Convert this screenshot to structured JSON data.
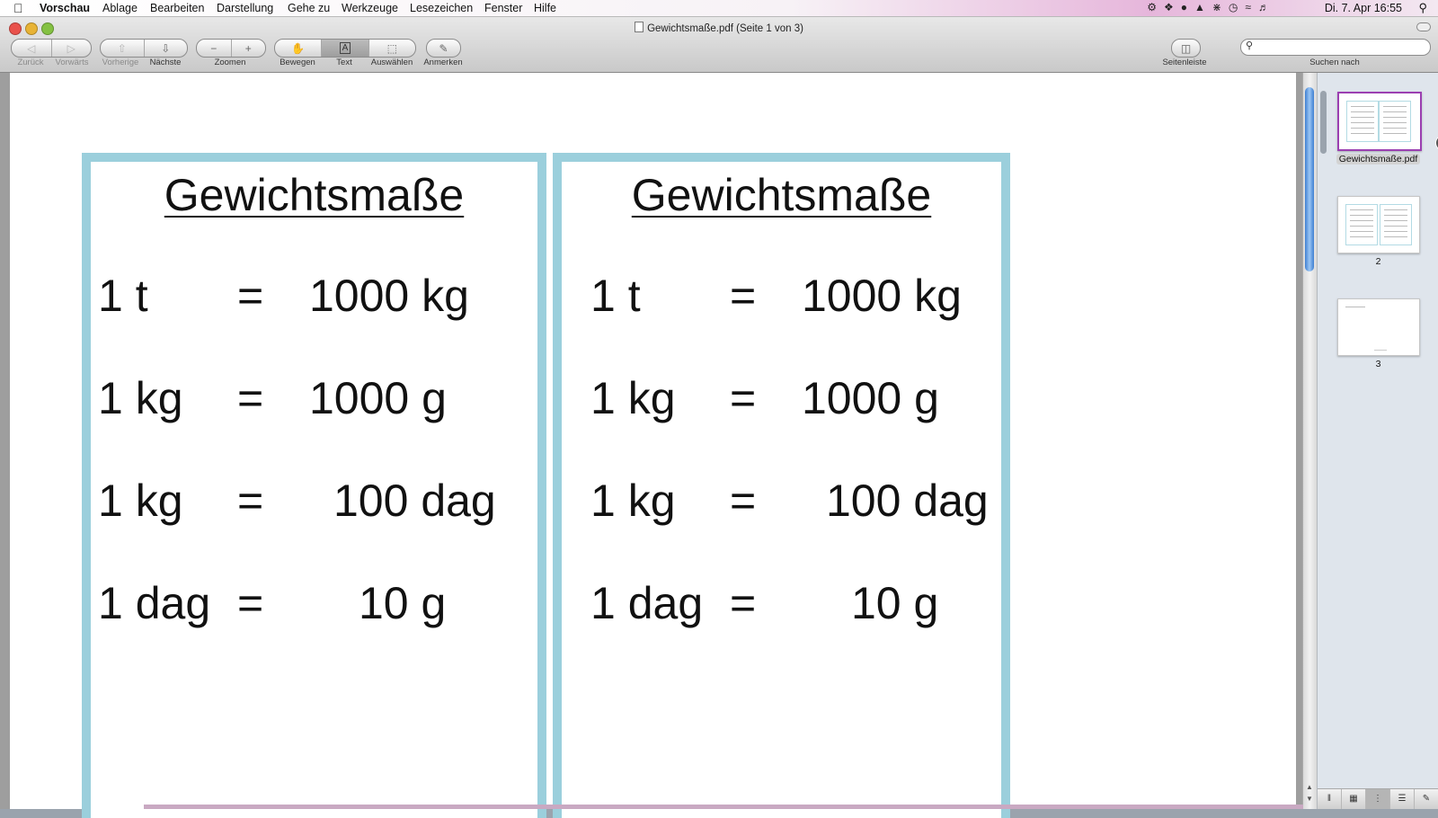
{
  "menubar": {
    "app_name": "Vorschau",
    "menus": [
      "Ablage",
      "Bearbeiten",
      "Darstellung",
      "Gehe zu",
      "Werkzeuge",
      "Lesezeichen",
      "Fenster",
      "Hilfe"
    ],
    "clock": "Di. 7. Apr  16:55"
  },
  "window": {
    "title": "Gewichtsmaße.pdf (Seite 1 von 3)"
  },
  "toolbar": {
    "back_label": "Zurück",
    "forward_label": "Vorwärts",
    "prev_label": "Vorherige",
    "next_label": "Nächste",
    "zoom_label": "Zoomen",
    "move_label": "Bewegen",
    "text_label": "Text",
    "select_label": "Auswählen",
    "annotate_label": "Anmerken",
    "sidebar_label": "Seitenleiste",
    "search_label": "Suchen nach",
    "search_value": ""
  },
  "document": {
    "cards": [
      {
        "title": "Gewichtsmaße",
        "rows": [
          {
            "left": "1 t",
            "eq": "=",
            "right": "1000 kg"
          },
          {
            "left": "1 kg",
            "eq": "=",
            "right": "1000 g"
          },
          {
            "left": "1 kg",
            "eq": "=",
            "right": "100 dag"
          },
          {
            "left": "1 dag",
            "eq": "=",
            "right": "10 g"
          }
        ]
      },
      {
        "title": "Gewichtsmaße",
        "rows": [
          {
            "left": "1 t",
            "eq": "=",
            "right": "1000 kg"
          },
          {
            "left": "1 kg",
            "eq": "=",
            "right": "1000 g"
          },
          {
            "left": "1 kg",
            "eq": "=",
            "right": "100 dag"
          },
          {
            "left": "1 dag",
            "eq": "=",
            "right": "10 g"
          }
        ]
      }
    ]
  },
  "sidebar": {
    "thumbnails": [
      {
        "label": "Gewichtsmaße.pdf"
      },
      {
        "label": "2"
      },
      {
        "label": "3"
      }
    ]
  },
  "colors": {
    "card_border": "#9bcfdc",
    "selection": "#9b3fb1"
  }
}
